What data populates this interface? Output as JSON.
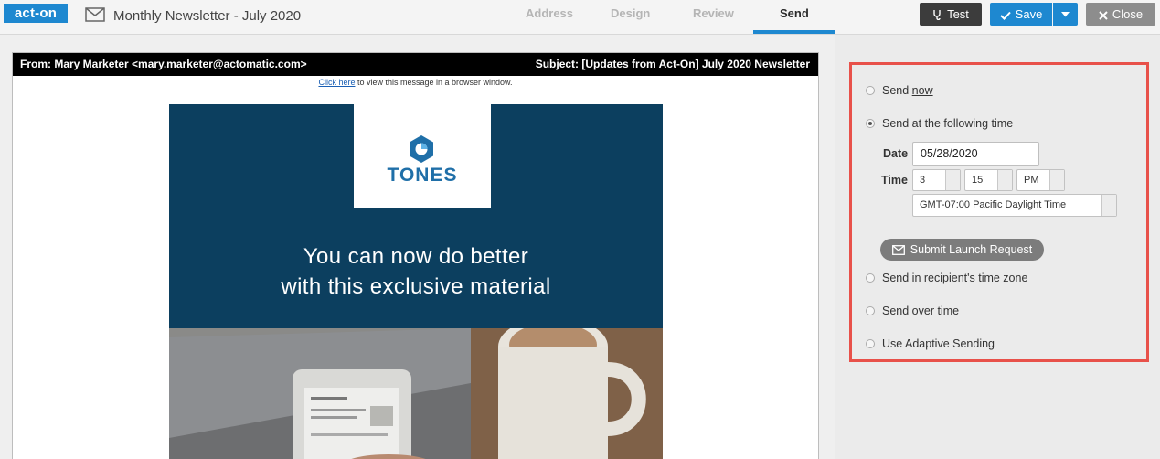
{
  "app": {
    "logo": "act-on",
    "title": "Monthly Newsletter - July 2020"
  },
  "steps": [
    {
      "label": "Address",
      "active": false
    },
    {
      "label": "Design",
      "active": false
    },
    {
      "label": "Review",
      "active": false
    },
    {
      "label": "Send",
      "active": true
    }
  ],
  "toolbar": {
    "test_label": "Test",
    "save_label": "Save",
    "close_label": "Close"
  },
  "email": {
    "from": "From: Mary Marketer <mary.marketer@actomatic.com>",
    "subject": "Subject: [Updates from Act-On] July 2020 Newsletter",
    "click_here": "Click here",
    "browser_text": " to view this message in a browser window.",
    "brand": "TONES",
    "headline_1": "You can now do better",
    "headline_2": "with this exclusive material"
  },
  "send_panel": {
    "send_prefix": "Send ",
    "send_now_link": "now",
    "send_at_time": "Send at the following time",
    "date_label": "Date",
    "date_value": "05/28/2020",
    "time_label": "Time",
    "hour": "3",
    "minute": "15",
    "ampm": "PM",
    "timezone": "GMT-07:00 Pacific Daylight Time",
    "submit_label": "Submit Launch Request",
    "recipient_tz": "Send in recipient's time zone",
    "over_time": "Send over time",
    "adaptive": "Use Adaptive Sending"
  },
  "colors": {
    "accent": "#1e88d0",
    "hero": "#0c3f5f",
    "highlight_border": "#e8514a"
  }
}
